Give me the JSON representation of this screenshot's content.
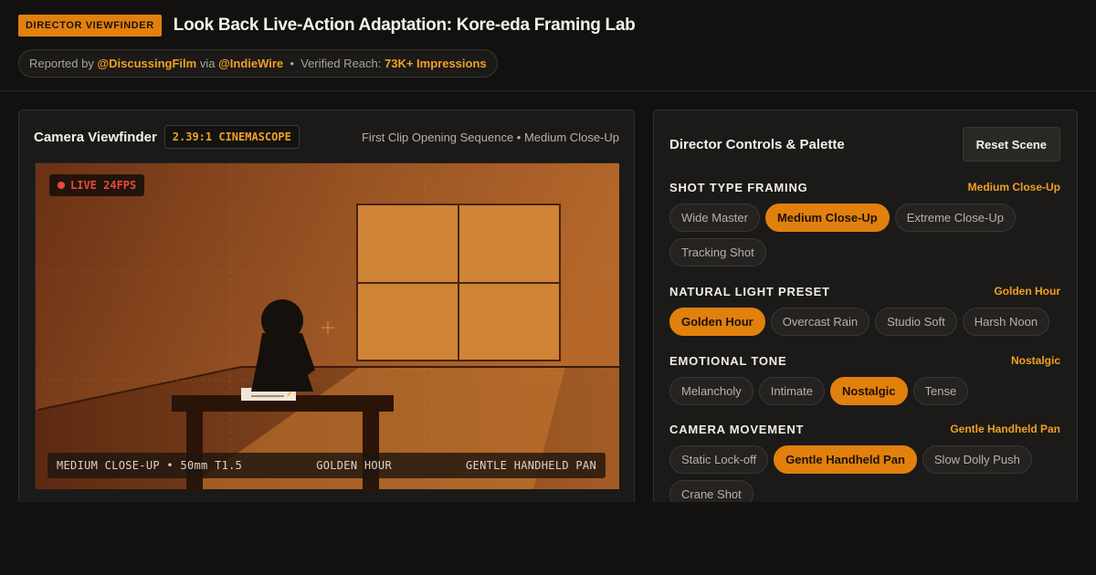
{
  "header": {
    "badge": "DIRECTOR VIEWFINDER",
    "title": "Look Back Live-Action Adaptation: Kore-eda Framing Lab",
    "meta": {
      "reported_prefix": "Reported by",
      "reporter": "@DiscussingFilm",
      "via_word": "via",
      "source": "@IndieWire",
      "separator": "•",
      "reach_label": "Verified Reach:",
      "reach_value": "73K+ Impressions"
    }
  },
  "viewfinder": {
    "title": "Camera Viewfinder",
    "aspect_ratio": "2.39:1 CINEMASCOPE",
    "subtitle": "First Clip Opening Sequence • Medium Close-Up",
    "live_label": "LIVE 24FPS",
    "hud": {
      "left": "MEDIUM CLOSE-UP • 50mm T1.5",
      "center": "GOLDEN HOUR",
      "right": "GENTLE HANDHELD PAN"
    },
    "colors": {
      "scene_warm": "#b5682a",
      "scene_dark": "#6a3115",
      "window_light": "#cf8436",
      "silhouette": "#15100c",
      "live_red": "#e54a3d"
    }
  },
  "controls": {
    "title": "Director Controls & Palette",
    "reset_label": "Reset Scene",
    "sections": [
      {
        "label": "SHOT TYPE FRAMING",
        "value": "Medium Close-Up",
        "options": [
          "Wide Master",
          "Medium Close-Up",
          "Extreme Close-Up",
          "Tracking Shot"
        ],
        "selected": 1
      },
      {
        "label": "NATURAL LIGHT PRESET",
        "value": "Golden Hour",
        "options": [
          "Golden Hour",
          "Overcast Rain",
          "Studio Soft",
          "Harsh Noon"
        ],
        "selected": 0
      },
      {
        "label": "EMOTIONAL TONE",
        "value": "Nostalgic",
        "options": [
          "Melancholy",
          "Intimate",
          "Nostalgic",
          "Tense"
        ],
        "selected": 2
      },
      {
        "label": "CAMERA MOVEMENT",
        "value": "Gentle Handheld Pan",
        "options": [
          "Static Lock-off",
          "Gentle Handheld Pan",
          "Slow Dolly Push",
          "Crane Shot"
        ],
        "selected": 1
      }
    ]
  },
  "theme": {
    "accent": "#e2800e",
    "accent_text": "#f0a023",
    "background": "#121110",
    "panel": "#1b1a18"
  }
}
